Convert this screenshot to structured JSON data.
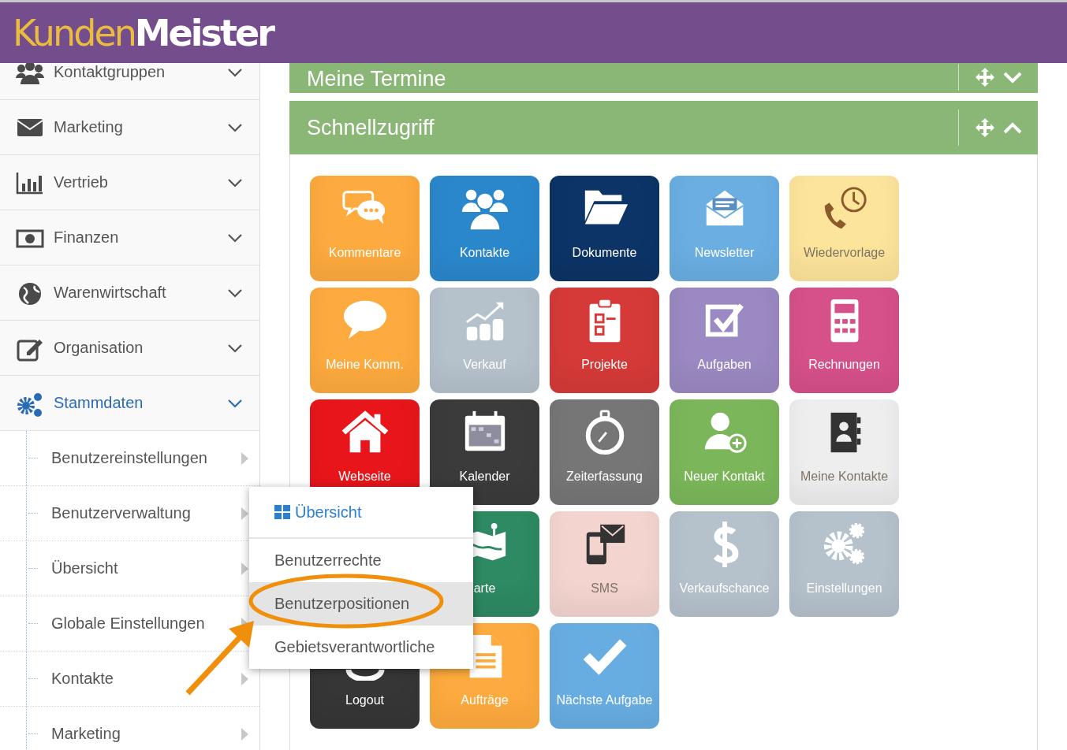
{
  "header": {
    "logo": "Kunden**Meister**"
  },
  "sidebar": {
    "items": [
      {
        "label": "Kontaktgruppen",
        "selected": false
      },
      {
        "label": "Marketing",
        "selected": false
      },
      {
        "label": "Vertrieb",
        "selected": false
      },
      {
        "label": "Finanzen",
        "selected": false
      },
      {
        "label": "Warenwirtschaft",
        "selected": false
      },
      {
        "label": "Organisation",
        "selected": false
      },
      {
        "label": "Stammdaten",
        "selected": true,
        "children": [
          {
            "label": "Benutzereinstellungen"
          },
          {
            "label": "Benutzerverwaltung"
          },
          {
            "label": "Übersicht"
          },
          {
            "label": "Globale Einstellungen"
          },
          {
            "label": "Kontakte"
          },
          {
            "label": "Marketing"
          }
        ]
      }
    ]
  },
  "panels": [
    {
      "title": "Meine Termine",
      "expanded": false
    },
    {
      "title": "Schnellzugriff",
      "expanded": true,
      "tiles": [
        {
          "kind": "tile",
          "label": "Kommentare",
          "color": "#fdaa3e"
        },
        {
          "kind": "tile",
          "label": "Kontakte",
          "color": "#2b87cc"
        },
        {
          "kind": "tile",
          "label": "Dokumente",
          "color": "#0c3466"
        },
        {
          "kind": "tile",
          "label": "Newsletter",
          "color": "#6aaee2"
        },
        {
          "kind": "tile",
          "label": "Wiedervorlage",
          "color": "#fde49b"
        },
        {
          "kind": "tile",
          "label": "Meine Komm.",
          "color": "#fdaa3e"
        },
        {
          "kind": "tile",
          "label": "Verkauf",
          "color": "#b5c1cb"
        },
        {
          "kind": "tile",
          "label": "Projekte",
          "color": "#d53a38"
        },
        {
          "kind": "tile",
          "label": "Aufgaben",
          "color": "#9a89c2"
        },
        {
          "kind": "tile",
          "label": "Rechnungen",
          "color": "#d6508a"
        },
        {
          "kind": "tile",
          "label": "Webseite",
          "color": "#e8161b"
        },
        {
          "kind": "tile",
          "label": "Kalender",
          "color": "#3b3b3b"
        },
        {
          "kind": "tile",
          "label": "Zeiterfassung",
          "color": "#767676"
        },
        {
          "kind": "tile",
          "label": "Neuer Kontakt",
          "color": "#7bb75a"
        },
        {
          "kind": "tile",
          "label": "Meine Kontakte",
          "color": "#eeeeee"
        },
        {
          "kind": "covered"
        },
        {
          "kind": "tile",
          "label": "arte",
          "color": "#2d8a62"
        },
        {
          "kind": "tile",
          "label": "SMS",
          "color": "#f3d4cf"
        },
        {
          "kind": "tile",
          "label": "Verkaufschance",
          "color": "#b5c1cb"
        },
        {
          "kind": "tile",
          "label": "Einstellungen",
          "color": "#b5c1cb"
        },
        {
          "kind": "tile",
          "label": "Logout",
          "color": "#363636"
        },
        {
          "kind": "tile",
          "label": "Aufträge",
          "color": "#fdaa3e"
        },
        {
          "kind": "tile",
          "label": "Nächste Aufgabe",
          "color": "#68ade2"
        }
      ]
    }
  ],
  "popup_menu": {
    "items": [
      {
        "label": "Übersicht",
        "kind": "heading",
        "selected": false
      },
      {
        "label": "Benutzerrechte",
        "kind": "item",
        "selected": false
      },
      {
        "label": "Benutzerpositionen",
        "kind": "item",
        "selected": true
      },
      {
        "label": "Gebietsverantwortliche",
        "kind": "item",
        "selected": false
      }
    ]
  }
}
